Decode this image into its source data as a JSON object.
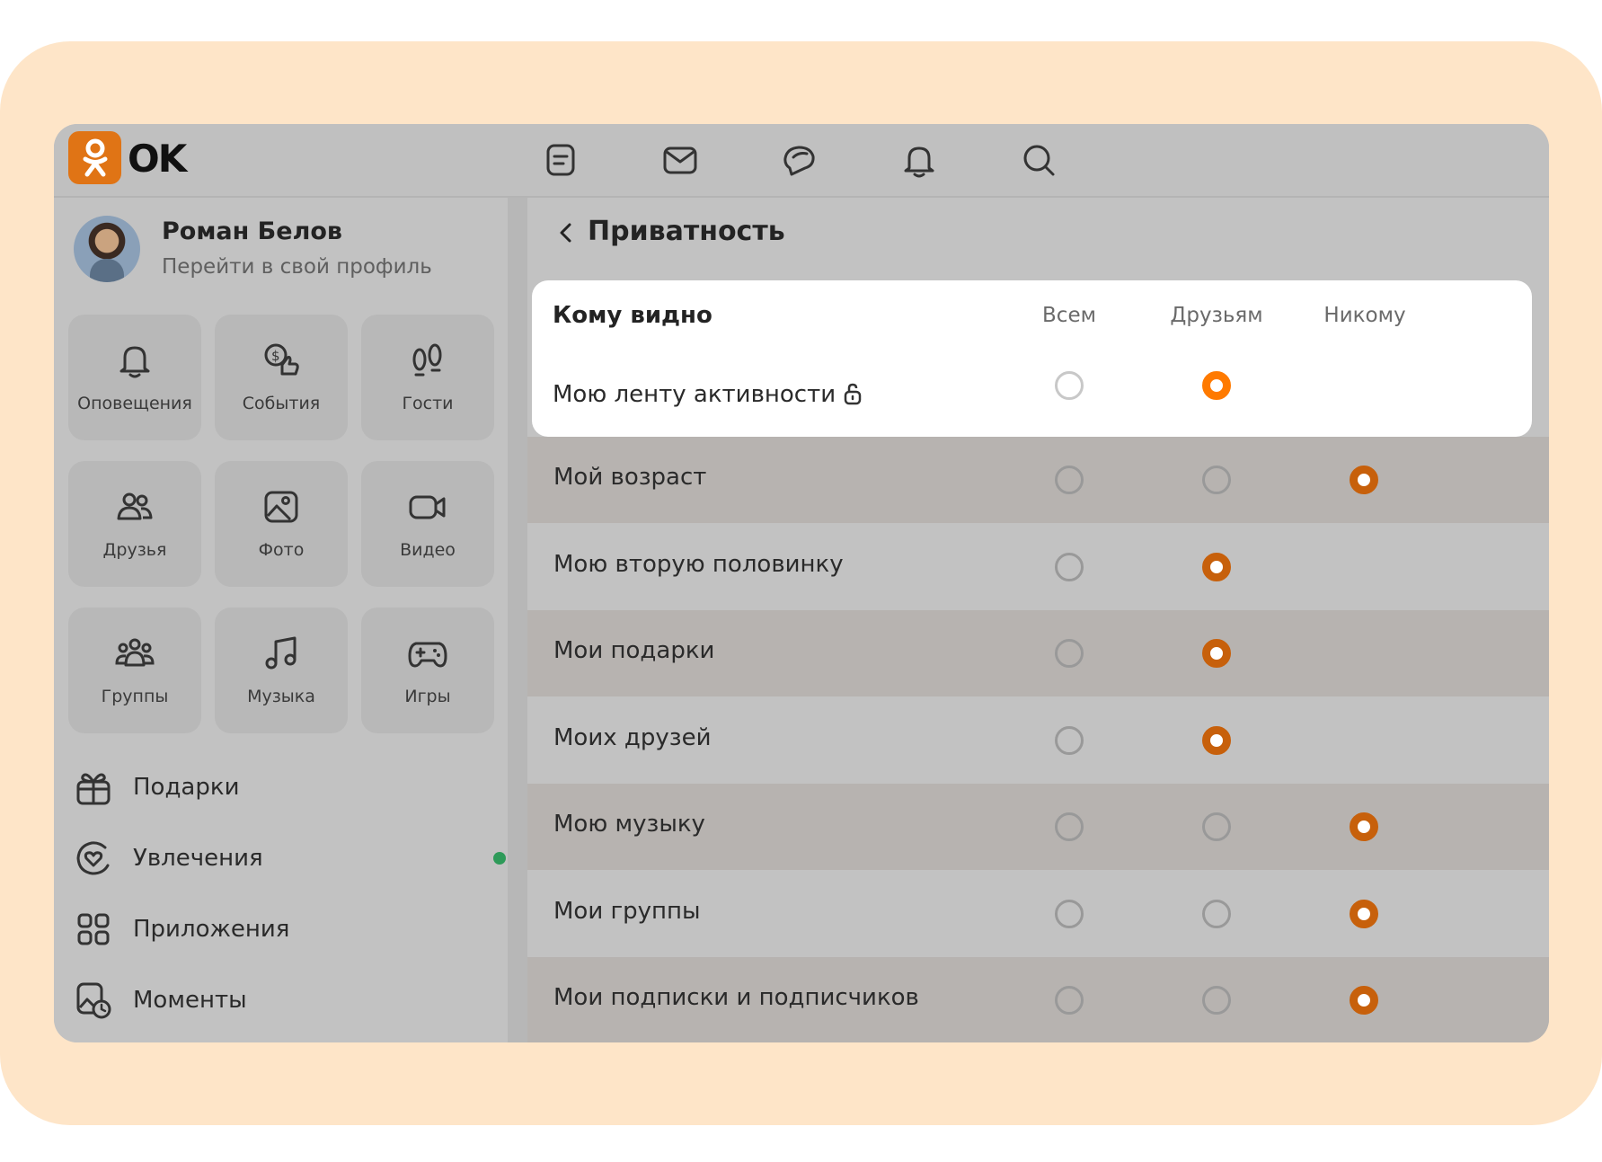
{
  "app": {
    "logo_text": "OK",
    "accent": "#e07415"
  },
  "topbar": {
    "icons": [
      "feed-icon",
      "mail-icon",
      "chat-icon",
      "bell-icon",
      "search-icon"
    ]
  },
  "sidebar": {
    "user": {
      "name": "Роман Белов",
      "profile_link": "Перейти в свой профиль"
    },
    "tiles": [
      {
        "label": "Оповещения",
        "icon": "bell-icon"
      },
      {
        "label": "События",
        "icon": "coin-like-icon"
      },
      {
        "label": "Гости",
        "icon": "footprints-icon"
      },
      {
        "label": "Друзья",
        "icon": "friends-icon"
      },
      {
        "label": "Фото",
        "icon": "photo-icon"
      },
      {
        "label": "Видео",
        "icon": "video-icon"
      },
      {
        "label": "Группы",
        "icon": "groups-icon"
      },
      {
        "label": "Музыка",
        "icon": "music-icon"
      },
      {
        "label": "Игры",
        "icon": "gamepad-icon"
      }
    ],
    "menu": [
      {
        "label": "Подарки",
        "icon": "gift-icon"
      },
      {
        "label": "Увлечения",
        "icon": "hobby-icon",
        "badge": "new"
      },
      {
        "label": "Приложения",
        "icon": "apps-icon"
      },
      {
        "label": "Моменты",
        "icon": "moments-icon"
      }
    ]
  },
  "privacy": {
    "title": "Приватность",
    "header": {
      "label": "Кому видно",
      "columns": [
        "Всем",
        "Друзьям",
        "Никому"
      ]
    },
    "highlighted_row": {
      "label": "Мою ленту активности",
      "selected": 1,
      "options": 2
    },
    "rows": [
      {
        "label": "Мой возраст",
        "selected": 2,
        "options": 3
      },
      {
        "label": "Мою вторую половинку",
        "selected": 1,
        "options": 2
      },
      {
        "label": "Мои подарки",
        "selected": 1,
        "options": 2
      },
      {
        "label": "Моих друзей",
        "selected": 1,
        "options": 2
      },
      {
        "label": "Мою музыку",
        "selected": 2,
        "options": 3
      },
      {
        "label": "Мои группы",
        "selected": 2,
        "options": 3
      },
      {
        "label": "Мои подписки и подписчиков",
        "selected": 2,
        "options": 3
      }
    ]
  }
}
